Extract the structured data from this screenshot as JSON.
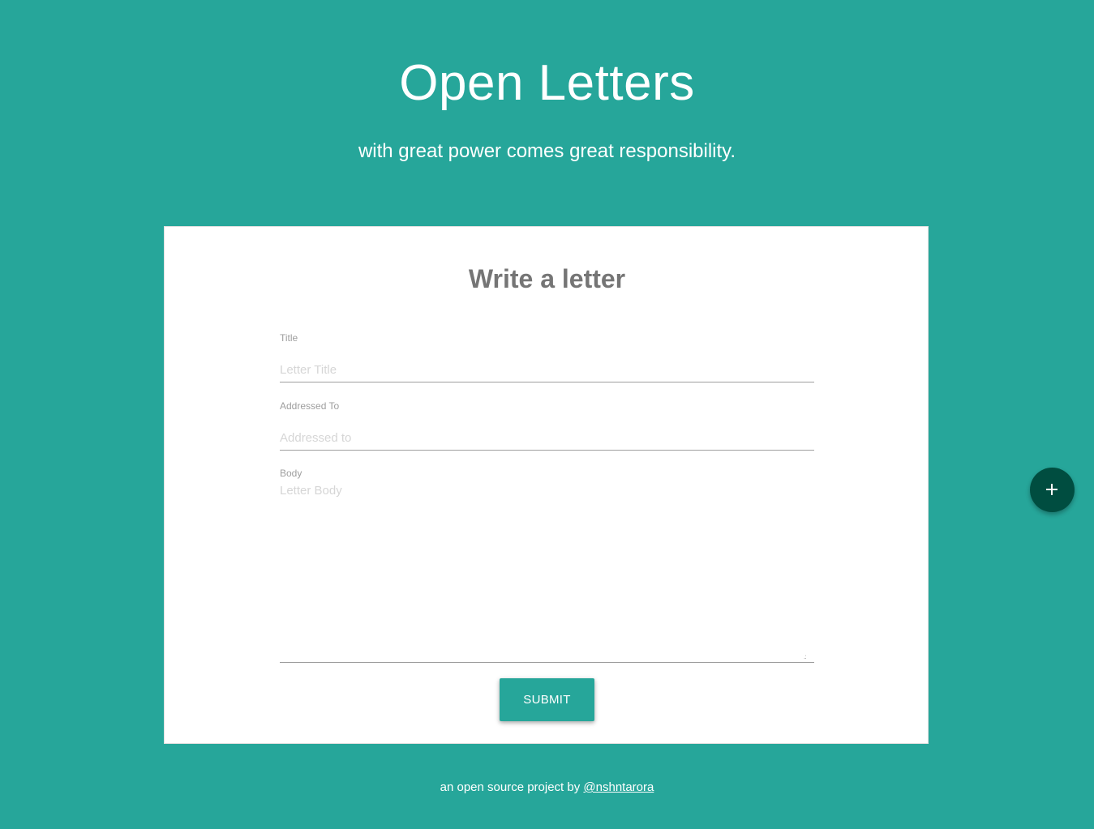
{
  "header": {
    "title": "Open Letters",
    "tagline": "with great power comes great responsibility."
  },
  "form": {
    "heading": "Write a letter",
    "title_field": {
      "label": "Title",
      "placeholder": "Letter Title",
      "value": ""
    },
    "addressed_field": {
      "label": "Addressed To",
      "placeholder": "Addressed to",
      "value": ""
    },
    "body_field": {
      "label": "Body",
      "placeholder": "Letter Body",
      "value": ""
    },
    "submit_label": "SUBMIT"
  },
  "fab": {
    "icon": "plus-icon",
    "color": "#004d40"
  },
  "footer": {
    "text": "an open source project by ",
    "link_text": "@nshntarora"
  },
  "colors": {
    "background": "#26a69a",
    "card": "#ffffff",
    "accent": "#26a69a",
    "fab": "#004d40"
  }
}
